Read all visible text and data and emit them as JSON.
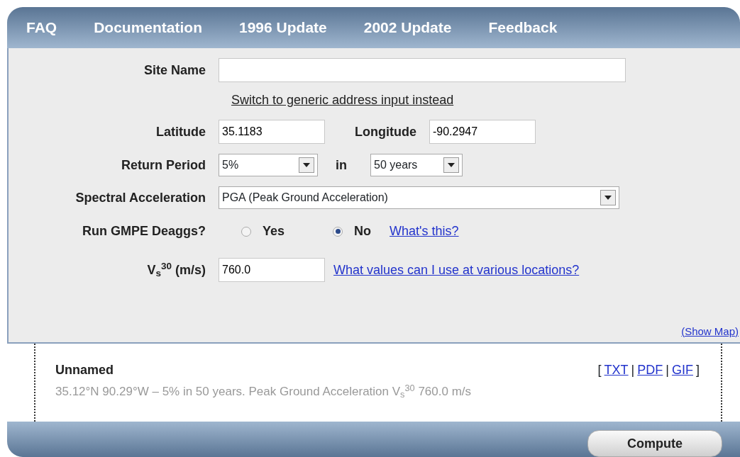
{
  "nav": [
    {
      "label": "FAQ"
    },
    {
      "label": "Documentation"
    },
    {
      "label": "1996 Update"
    },
    {
      "label": "2002 Update"
    },
    {
      "label": "Feedback"
    }
  ],
  "form": {
    "site_name": {
      "label": "Site Name"
    },
    "switch_link": "Switch to generic address input instead",
    "latitude": {
      "label": "Latitude",
      "value": "35.1183"
    },
    "longitude": {
      "label": "Longitude",
      "value": "-90.2947"
    },
    "return_period": {
      "label": "Return Period",
      "value": "5%",
      "connector": "in",
      "period": "50 years"
    },
    "spectral": {
      "label": "Spectral Acceleration",
      "value": "PGA (Peak Ground Acceleration)"
    },
    "deaggs": {
      "label": "Run GMPE Deaggs?",
      "options": [
        {
          "label": "Yes",
          "selected": false
        },
        {
          "label": "No",
          "selected": true
        }
      ],
      "help_link": "What's this?"
    },
    "vs30": {
      "label": "V$_{s}$$^{30}$ (m/s)",
      "value": "760.0",
      "help_link": "What values can I use at various locations?"
    },
    "show_map": "(Show Map)"
  },
  "result": {
    "title": "Unnamed",
    "open": "[",
    "separator": "|",
    "close": "]",
    "links": [
      "TXT",
      "PDF",
      "GIF"
    ],
    "description": "35.12°N 90.29°W – 5% in 50 years. Peak Ground Acceleration V$_{s}$$^{30}$ 760.0 m/s"
  },
  "compute_button": "Compute"
}
